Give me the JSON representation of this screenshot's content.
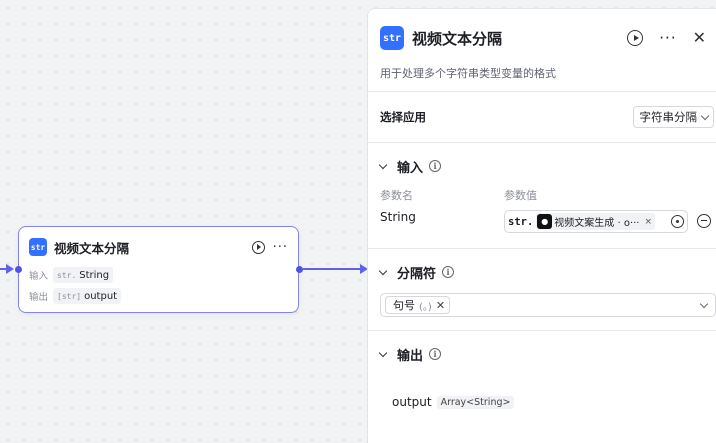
{
  "node": {
    "title": "视频文本分隔",
    "icon_text": "str",
    "input_label": "输入",
    "input_type": "str.",
    "input_value": "String",
    "output_label": "输出",
    "output_type": "[str]",
    "output_value": "output"
  },
  "panel": {
    "title": "视频文本分隔",
    "icon_text": "str",
    "description": "用于处理多个字符串类型变量的格式",
    "app_select": {
      "label": "选择应用",
      "value": "字符串分隔"
    },
    "input_section": {
      "title": "输入",
      "col_name": "参数名",
      "col_value": "参数值",
      "param_name": "String",
      "value_type": "str.",
      "ref_label": "视频文案生成 · o···",
      "ref_remove": "×"
    },
    "separator_section": {
      "title": "分隔符",
      "selected_label": "句号",
      "selected_symbol": "(。)",
      "tag_remove": "✕"
    },
    "output_section": {
      "title": "输出",
      "output_name": "output",
      "output_type": "Array<String>"
    }
  },
  "icons": {
    "play": "play-icon",
    "more": "more-icon",
    "close": "close-icon",
    "info": "info-icon",
    "chevron": "chevron-down-icon",
    "target": "target-icon",
    "remove": "remove-icon"
  },
  "colors": {
    "accent": "#4d53e8",
    "app_icon": "#3370ff",
    "node_border": "#7e86f0"
  }
}
